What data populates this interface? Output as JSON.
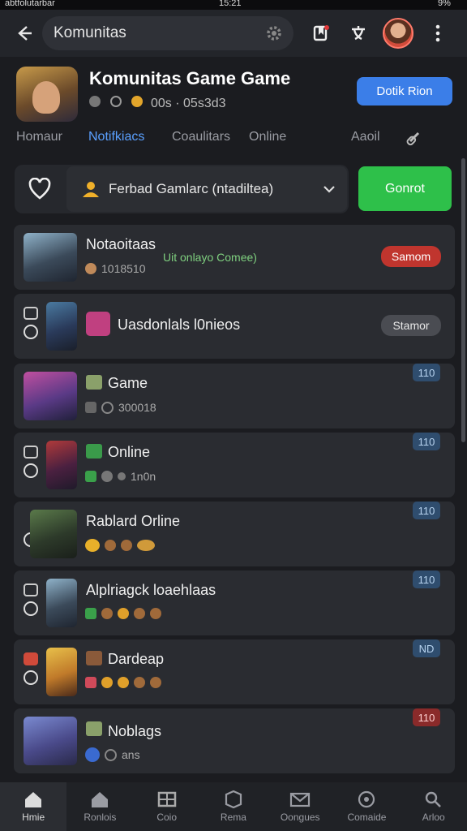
{
  "statusbar": {
    "left": "abtfolutarbar",
    "time": "15:21",
    "battery": "9%"
  },
  "topbar": {
    "search_text": "Komunitas"
  },
  "header": {
    "title": "Komunitas Game Game",
    "meta_text": "00s · 05s3d3",
    "primary_button": "Dotik Rion",
    "tabs": [
      "Homaur",
      "Notifkiacs",
      "Coaulitars",
      "Online",
      "Aaoil"
    ]
  },
  "filter": {
    "dropdown_text": "Ferbad Gamlarc (ntadiltea)",
    "action_button": "Gonrot"
  },
  "cards": [
    {
      "name": "Notaoitaas",
      "sub": "1018510",
      "extra": "Uit onlayo Comee)",
      "badge": "Samom"
    },
    {
      "name": "Uasdonlals l0nieos",
      "badge": "Stamor"
    },
    {
      "name": "Game",
      "sub": "300018",
      "tag": "110"
    },
    {
      "name": "Online",
      "sub": "1n0n",
      "tag": "110"
    },
    {
      "name": "Rablard Orline",
      "tag": "110"
    },
    {
      "name": "Alplriagck loaehlaas",
      "tag": "110"
    },
    {
      "name": "Dardeap",
      "tag": "ND"
    },
    {
      "name": "Noblags",
      "sub": "ans",
      "tag": "110"
    }
  ],
  "bottom_nav": [
    "Hmie",
    "Ronlois",
    "Coio",
    "Rema",
    "Oongues",
    "Comaide",
    "Arloo"
  ],
  "colors": {
    "accent_blue": "#3b7ee8",
    "accent_green": "#2ec04a",
    "badge_red": "#c0352e",
    "tag_blue": "#2f4d6e"
  }
}
